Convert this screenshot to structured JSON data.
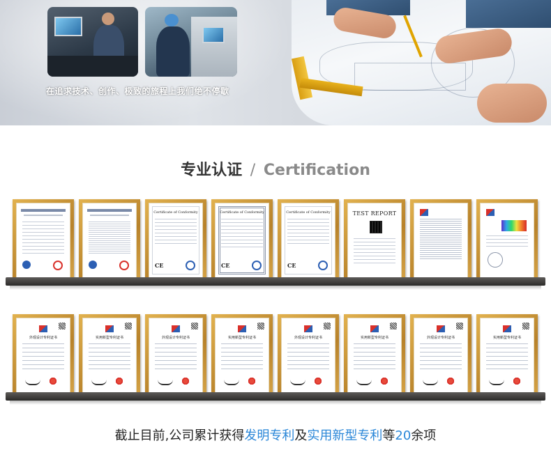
{
  "hero": {
    "caption": "在追求技术、创作、极致的旅程上我们绝不停歇"
  },
  "section": {
    "title_cn": "专业认证",
    "separator": "/",
    "title_en": "Certification"
  },
  "certificates": [
    {
      "kind": "ccc",
      "label": ""
    },
    {
      "kind": "ccc",
      "label": ""
    },
    {
      "kind": "ce",
      "label": "Certificate of Conformity"
    },
    {
      "kind": "ce",
      "label": "Certificate of Conformity"
    },
    {
      "kind": "ce",
      "label": "Certificate of Conformity"
    },
    {
      "kind": "report",
      "label": "TEST REPORT"
    },
    {
      "kind": "doc",
      "label": ""
    },
    {
      "kind": "spectrum",
      "label": ""
    }
  ],
  "patents": [
    {
      "label": "外观设计专利证书"
    },
    {
      "label": "实用新型专利证书"
    },
    {
      "label": "外观设计专利证书"
    },
    {
      "label": "实用新型专利证书"
    },
    {
      "label": "外观设计专利证书"
    },
    {
      "label": "实用新型专利证书"
    },
    {
      "label": "外观设计专利证书"
    },
    {
      "label": "实用新型专利证书"
    }
  ],
  "footer": {
    "prefix": "截止目前,公司累计获得",
    "highlight_1": "发明专利",
    "middle": "及",
    "highlight_2": "实用新型专利",
    "joiner": "等",
    "count": "20",
    "suffix": "余项"
  },
  "colors": {
    "accent": "#2b87d8",
    "frame_gold": "#c9953a",
    "shelf": "#3c3a38",
    "title": "#333333",
    "title_en": "#8a8a8a"
  }
}
